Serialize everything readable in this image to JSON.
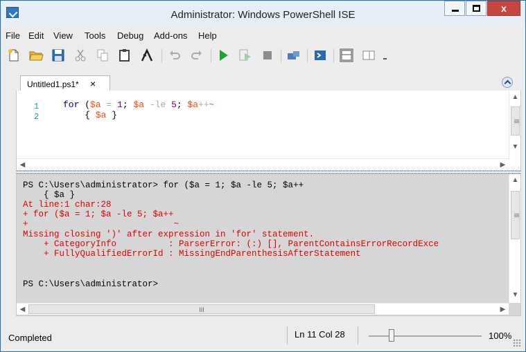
{
  "window": {
    "title": "Administrator: Windows PowerShell ISE",
    "close_glyph": "x"
  },
  "menu": [
    "File",
    "Edit",
    "View",
    "Tools",
    "Debug",
    "Add-ons",
    "Help"
  ],
  "toolbar": {
    "icons": [
      "new-file-icon",
      "open-folder-icon",
      "save-icon",
      "cut-icon",
      "copy-icon",
      "paste-icon",
      "clear-console-icon",
      "undo-icon",
      "redo-icon",
      "run-icon",
      "run-selection-icon",
      "stop-icon",
      "remote-powershell-icon",
      "powershell-console-icon",
      "show-script-pane-top-icon",
      "show-script-pane-right-icon",
      "more-icon"
    ]
  },
  "tab": {
    "label": "Untitled1.ps1*",
    "close_glyph": "×"
  },
  "editor": {
    "line_numbers": [
      "1",
      "2"
    ],
    "line1": {
      "kw": "for",
      "p1": " (",
      "v1": "$a",
      "eq": " = ",
      "n1": "1",
      "s1": "; ",
      "v2": "$a",
      "le": " -le ",
      "n2": "5",
      "s2": "; ",
      "v3": "$a",
      "pp": "++",
      "squiggle": "~"
    },
    "line2": {
      "indent": "    ",
      "open": "{ ",
      "v": "$a",
      "close": " }"
    }
  },
  "console": {
    "lines": [
      {
        "text": "PS C:\\Users\\administrator> for ($a = 1; $a -le 5; $a++",
        "kind": "normal"
      },
      {
        "text": "    { $a }",
        "kind": "normal"
      },
      {
        "text": "At line:1 char:28",
        "kind": "error"
      },
      {
        "text": "+ for ($a = 1; $a -le 5; $a++",
        "kind": "error"
      },
      {
        "text": "+                            ~",
        "kind": "error"
      },
      {
        "text": "Missing closing ')' after expression in 'for' statement.",
        "kind": "error"
      },
      {
        "text": "    + CategoryInfo          : ParserError: (:) [], ParentContainsErrorRecordExce",
        "kind": "error"
      },
      {
        "text": "    + FullyQualifiedErrorId : MissingEndParenthesisAfterStatement",
        "kind": "error"
      },
      {
        "text": "",
        "kind": "normal"
      },
      {
        "text": "",
        "kind": "normal"
      },
      {
        "text": "PS C:\\Users\\administrator>",
        "kind": "normal"
      }
    ],
    "hscroll_grip": "III"
  },
  "status": {
    "text": "Completed",
    "position": "Ln 11  Col 28",
    "zoom": "100%",
    "zoom_level_percent": 100
  },
  "colors": {
    "keyword": "#00008b",
    "variable": "#ff4500",
    "operator": "#a9a9a9",
    "number": "#800080",
    "error": "#e00000",
    "console_bg": "#d6d6d6",
    "title_close": "#c74642"
  }
}
